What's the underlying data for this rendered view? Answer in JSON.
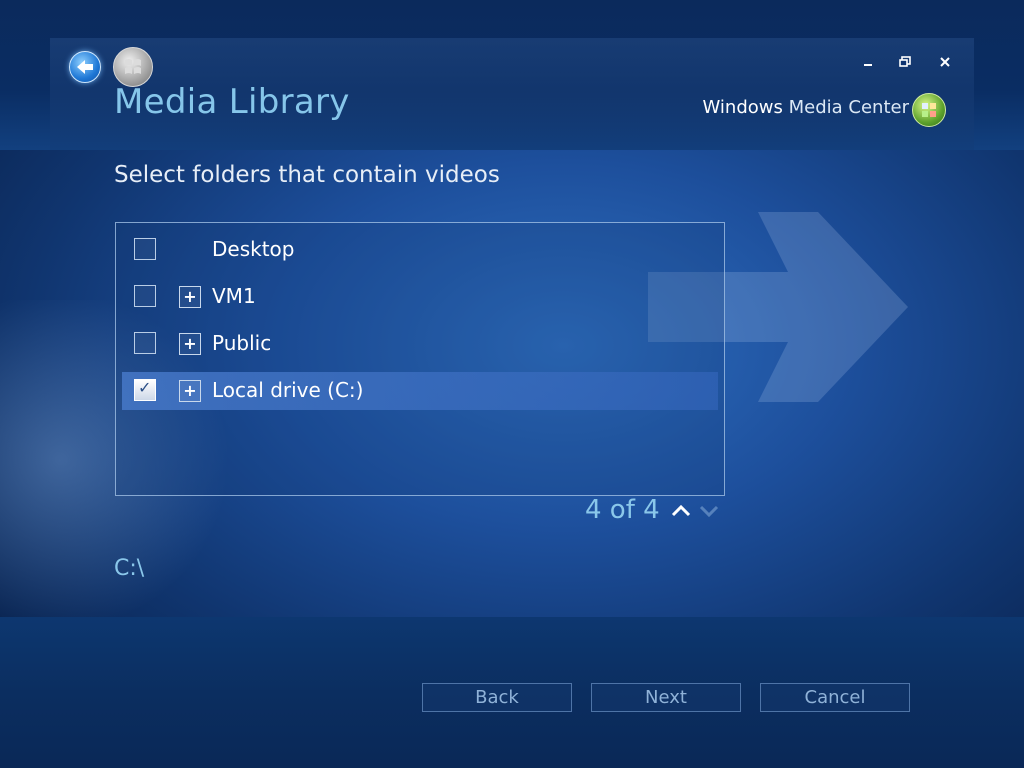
{
  "header": {
    "title": "Media Library",
    "brand_bold": "Windows",
    "brand_light": "Media Center",
    "controls": [
      "minimize-icon",
      "restore-icon",
      "close-icon"
    ]
  },
  "main": {
    "subtitle": "Select folders that contain videos",
    "folders": [
      {
        "label": "Desktop",
        "checked": false,
        "expandable": false
      },
      {
        "label": "VM1",
        "checked": false,
        "expandable": true
      },
      {
        "label": "Public",
        "checked": false,
        "expandable": true
      },
      {
        "label": "Local drive (C:)",
        "checked": true,
        "expandable": true
      }
    ],
    "expander_glyph": "+",
    "check_glyph": "✓",
    "pager": "4 of 4",
    "path": "C:\\"
  },
  "footer": {
    "back_label": "Back",
    "next_label": "Next",
    "cancel_label": "Cancel"
  },
  "colors": {
    "accent": "#86c6ea",
    "background": "#1d4f9c"
  }
}
